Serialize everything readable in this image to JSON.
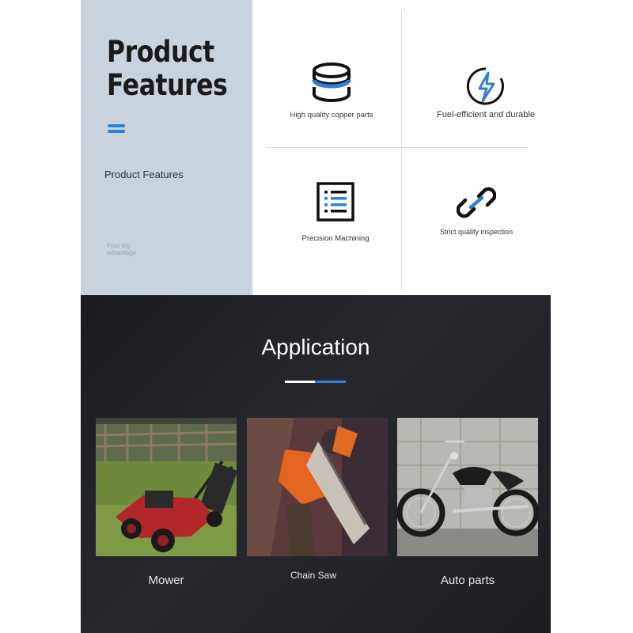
{
  "features_section": {
    "headline_line1": "Product",
    "headline_line2": "Features",
    "subtitle": "Product Features",
    "advantage_note": "Four big advantage",
    "features": [
      {
        "label": "High quality copper parts",
        "icon": "stacked-coins-icon"
      },
      {
        "label": "Fuel-efficient and durable",
        "icon": "lightning-icon"
      },
      {
        "label": "Precision Machining",
        "icon": "checklist-icon"
      },
      {
        "label": "Strict quality inspection",
        "icon": "chain-link-icon"
      }
    ]
  },
  "application_section": {
    "title": "Application",
    "items": [
      {
        "label": "Mower",
        "image": "lawn-mower-photo"
      },
      {
        "label": "Chain Saw",
        "image": "chainsaw-photo"
      },
      {
        "label": "Auto parts",
        "image": "motorcycle-photo"
      }
    ]
  },
  "colors": {
    "accent_blue": "#2f7fd6",
    "left_panel": "#c9d3de",
    "dark_bg": "#1f2025"
  }
}
